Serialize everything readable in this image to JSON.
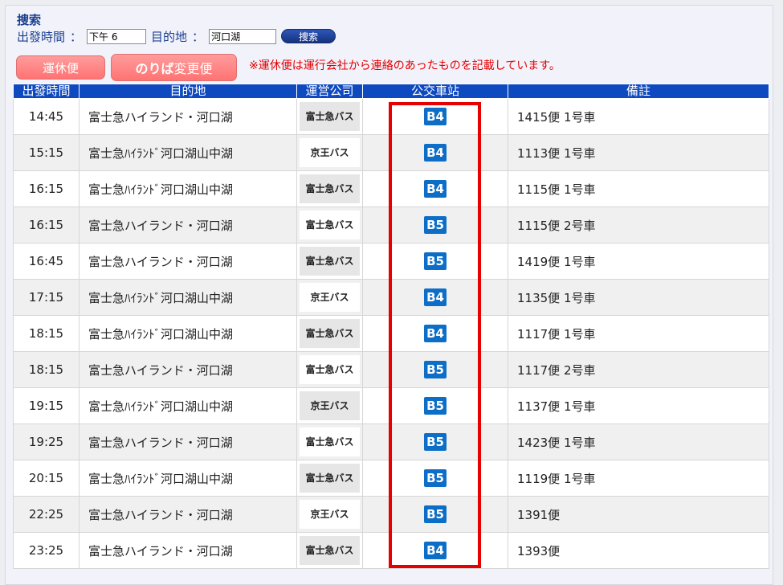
{
  "search": {
    "title": "捜索",
    "departure_label": "出發時間",
    "separator": "：",
    "departure_value": "下午 6",
    "destination_label": "目的地",
    "destination_value": "河口湖",
    "button_label": "捜索"
  },
  "buttons": {
    "suspended_label": "運休便",
    "platform_change_big": "のりば",
    "platform_change_small": "変更便"
  },
  "notice": "※運休便は運行会社から連絡のあったものを記載しています。",
  "table": {
    "headers": [
      "出發時間",
      "目的地",
      "運営公司",
      "公交車站",
      "備註"
    ],
    "rows": [
      {
        "time": "14:45",
        "dest": "富士急ハイランド・河口湖",
        "op": "富士急バス",
        "stop": "B4",
        "note": "1415便 1号車"
      },
      {
        "time": "15:15",
        "dest": "富士急ﾊｲﾗﾝﾄﾞ河口湖山中湖",
        "op": "京王バス",
        "stop": "B4",
        "note": "1113便 1号車"
      },
      {
        "time": "16:15",
        "dest": "富士急ﾊｲﾗﾝﾄﾞ河口湖山中湖",
        "op": "富士急バス",
        "stop": "B4",
        "note": "1115便 1号車"
      },
      {
        "time": "16:15",
        "dest": "富士急ハイランド・河口湖",
        "op": "富士急バス",
        "stop": "B5",
        "note": "1115便 2号車"
      },
      {
        "time": "16:45",
        "dest": "富士急ハイランド・河口湖",
        "op": "富士急バス",
        "stop": "B5",
        "note": "1419便 1号車"
      },
      {
        "time": "17:15",
        "dest": "富士急ﾊｲﾗﾝﾄﾞ河口湖山中湖",
        "op": "京王バス",
        "stop": "B4",
        "note": "1135便 1号車"
      },
      {
        "time": "18:15",
        "dest": "富士急ﾊｲﾗﾝﾄﾞ河口湖山中湖",
        "op": "富士急バス",
        "stop": "B4",
        "note": "1117便 1号車"
      },
      {
        "time": "18:15",
        "dest": "富士急ハイランド・河口湖",
        "op": "富士急バス",
        "stop": "B5",
        "note": "1117便 2号車"
      },
      {
        "time": "19:15",
        "dest": "富士急ﾊｲﾗﾝﾄﾞ河口湖山中湖",
        "op": "京王バス",
        "stop": "B5",
        "note": "1137便 1号車"
      },
      {
        "time": "19:25",
        "dest": "富士急ハイランド・河口湖",
        "op": "富士急バス",
        "stop": "B5",
        "note": "1423便 1号車"
      },
      {
        "time": "20:15",
        "dest": "富士急ﾊｲﾗﾝﾄﾞ河口湖山中湖",
        "op": "富士急バス",
        "stop": "B5",
        "note": "1119便 1号車"
      },
      {
        "time": "22:25",
        "dest": "富士急ハイランド・河口湖",
        "op": "京王バス",
        "stop": "B5",
        "note": "1391便"
      },
      {
        "time": "23:25",
        "dest": "富士急ハイランド・河口湖",
        "op": "富士急バス",
        "stop": "B4",
        "note": "1393便"
      }
    ]
  },
  "colors": {
    "header_bg": "#0e49c0",
    "stop_badge": "#0d6ec7",
    "highlight": "#e60000",
    "notice": "#e40000",
    "pill": "#ff7f7f"
  }
}
